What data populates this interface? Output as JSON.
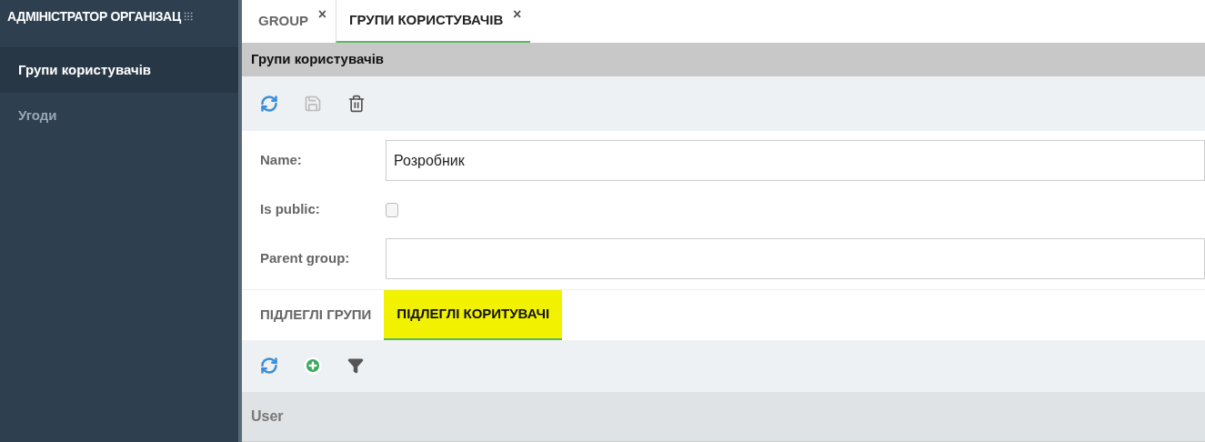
{
  "sidebar": {
    "title": "АДМІНІСТРАТОР ОРГАНІЗАЦ",
    "items": [
      {
        "label": "Групи користувачів",
        "selected": true
      },
      {
        "label": "Угоди",
        "selected": false
      }
    ]
  },
  "tabs": [
    {
      "label": "GROUP",
      "selected": false,
      "close": "×"
    },
    {
      "label": "ГРУПИ КОРИСТУВАЧІВ",
      "selected": true,
      "close": "×"
    }
  ],
  "panel": {
    "title": "Групи користувачів",
    "form": [
      {
        "kind": "text",
        "label": "Name:",
        "value": "Розробник"
      },
      {
        "kind": "checkbox",
        "label": "Is public:",
        "checked": false
      },
      {
        "kind": "text",
        "label": "Parent group:"
      }
    ],
    "subtabs": [
      {
        "label": "ПІДЛЕГЛІ ГРУПИ",
        "selected": false,
        "highlighted": false
      },
      {
        "label": "ПІДЛЕГЛІ КОРИТУВАЧІ",
        "selected": true,
        "highlighted": true
      }
    ],
    "grid": {
      "columns": [
        "User"
      ]
    }
  }
}
